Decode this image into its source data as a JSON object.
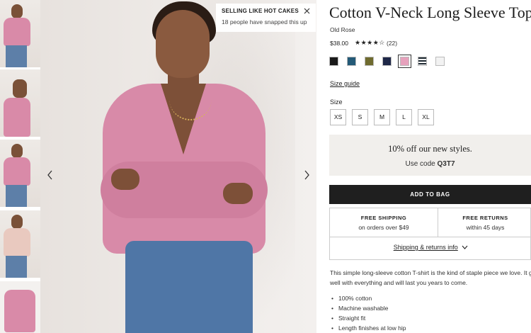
{
  "toast": {
    "title": "SELLING LIKE HOT CAKES",
    "subtitle": "18 people have snapped this up",
    "close_icon": "close-icon"
  },
  "gallery": {
    "prev_icon": "chevron-left-icon",
    "next_icon": "chevron-right-icon",
    "thumbnails": [
      "thumbnail-1",
      "thumbnail-2",
      "thumbnail-3",
      "thumbnail-4",
      "thumbnail-5"
    ]
  },
  "product": {
    "title": "Cotton V-Neck Long Sleeve Top",
    "color_name": "Old Rose",
    "price": "$38.00",
    "rating_stars": "★★★★☆",
    "rating_value": 3.5,
    "reviews": "(22)",
    "swatches": [
      {
        "name": "black",
        "hex": "#1a1a1a"
      },
      {
        "name": "teal-blue",
        "hex": "#245a77"
      },
      {
        "name": "olive",
        "hex": "#6f6b2f"
      },
      {
        "name": "navy",
        "hex": "#1e2747"
      },
      {
        "name": "old-rose",
        "hex": "#e6a1bc",
        "selected": true
      },
      {
        "name": "stripe",
        "hex": "#1f2a33"
      },
      {
        "name": "white",
        "hex": "#f2f2f2"
      }
    ]
  },
  "size": {
    "guide_label": "Size guide",
    "label": "Size",
    "options": [
      "XS",
      "S",
      "M",
      "L",
      "XL"
    ]
  },
  "promo": {
    "headline": "10% off our new styles.",
    "code_prefix": "Use code",
    "code": "Q3T7"
  },
  "cart": {
    "add_label": "ADD TO BAG"
  },
  "shipping": {
    "free_shipping_title": "FREE SHIPPING",
    "free_shipping_sub": "on orders over $49",
    "free_returns_title": "FREE RETURNS",
    "free_returns_sub": "within 45 days",
    "link_label": "Shipping & returns info",
    "link_icon": "chevron-down-icon"
  },
  "description": {
    "text_line1": "This simple long-sleeve cotton T-shirt is the kind of staple piece we love. It g",
    "text_line2": "well with everything and will last you years to come.",
    "bullets": [
      "100% cotton",
      "Machine washable",
      "Straight fit",
      "Length finishes at low hip"
    ]
  },
  "colors": {
    "button_bg": "#1f1f1f",
    "promo_bg": "#f1efec",
    "shirt_pink": "#d88aa8"
  }
}
